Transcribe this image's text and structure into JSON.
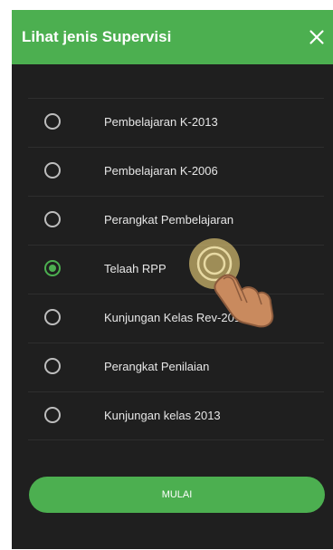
{
  "dialog": {
    "title": "Lihat jenis Supervisi",
    "close_icon": "close-icon",
    "options": [
      {
        "label": "Pembelajaran K-2013",
        "selected": false
      },
      {
        "label": "Pembelajaran K-2006",
        "selected": false
      },
      {
        "label": "Perangkat Pembelajaran",
        "selected": false
      },
      {
        "label": "Telaah RPP",
        "selected": true
      },
      {
        "label": "Kunjungan Kelas Rev-2018",
        "selected": false
      },
      {
        "label": "Perangkat Penilaian",
        "selected": false
      },
      {
        "label": "Kunjungan kelas 2013",
        "selected": false
      }
    ],
    "start_button_label": "MULAI"
  },
  "colors": {
    "accent": "#4caf50",
    "background": "#1f1f1f",
    "text": "#e6e6e6"
  },
  "overlay": {
    "icon": "tap-hand-icon"
  }
}
